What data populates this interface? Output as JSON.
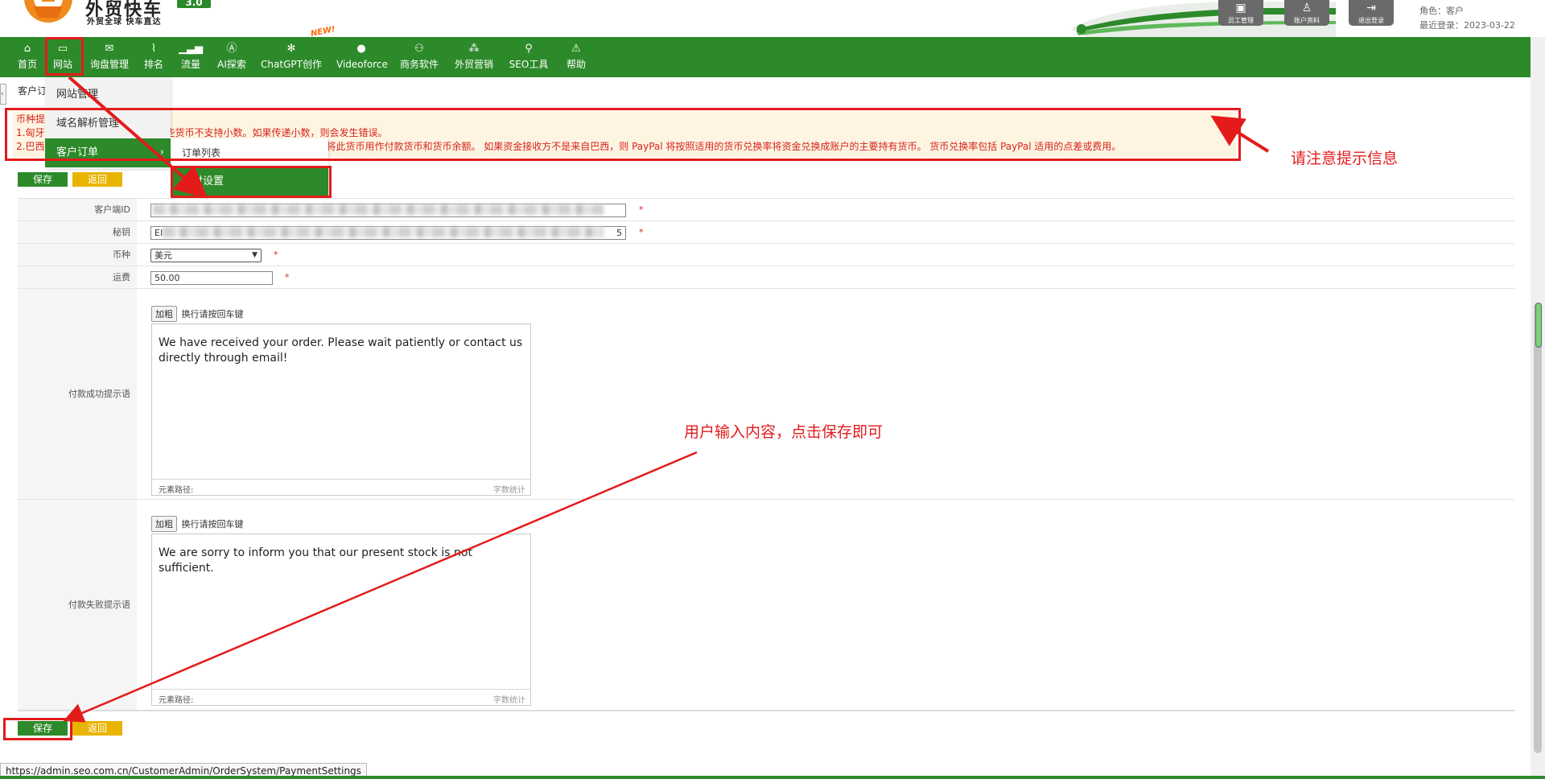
{
  "header": {
    "brand_title": "外贸快车",
    "brand_sub": "外贸全球 快车直达",
    "version": "3.0",
    "buttons": [
      {
        "label": "员工管理",
        "icon": "staff-icon"
      },
      {
        "label": "账户资料",
        "icon": "account-icon"
      },
      {
        "label": "退出登录",
        "icon": "logout-icon"
      }
    ],
    "role": "角色：客户",
    "last_login": "最近登录：2023-03-22"
  },
  "nav": {
    "items": [
      {
        "label": "首页",
        "icon": "home-icon"
      },
      {
        "label": "网站",
        "icon": "website-icon"
      },
      {
        "label": "询盘管理",
        "icon": "mail-icon"
      },
      {
        "label": "排名",
        "icon": "ranking-icon"
      },
      {
        "label": "流量",
        "icon": "traffic-icon"
      },
      {
        "label": "AI探索",
        "icon": "ai-icon"
      },
      {
        "label": "ChatGPT创作",
        "icon": "chatgpt-icon"
      },
      {
        "label": "Videoforce",
        "icon": "video-icon"
      },
      {
        "label": "商务软件",
        "icon": "software-icon"
      },
      {
        "label": "外贸营销",
        "icon": "marketing-icon"
      },
      {
        "label": "SEO工具",
        "icon": "seo-search-icon"
      },
      {
        "label": "帮助",
        "icon": "help-icon"
      }
    ],
    "new_badge": "NEW!"
  },
  "page_title": "客户订",
  "dropdown": {
    "items": [
      "网站管理",
      "域名解析管理",
      "客户订单"
    ],
    "submenu": [
      "订单列表",
      "支付设置"
    ]
  },
  "notice": {
    "line0": "币种提",
    "line1_prefix": "1.匈牙",
    "line1_suffix": "这些货币不支持小数。如果传递小数，则会发生错误。",
    "line2_prefix": "2.巴西",
    "line2_suffix": "将此货币用作付款货币和货币余额。 如果资金接收方不是来自巴西，则 PayPal 将按照适用的货币兑换率将资金兑换成账户的主要持有货币。 货币兑换率包括 PayPal 适用的点差或费用。"
  },
  "buttons": {
    "save": "保存",
    "back": "返回"
  },
  "form": {
    "client_id_label": "客户端ID",
    "secret_label": "秘钥",
    "secret_value_start": "EI",
    "secret_value_end": "5",
    "currency_label": "币种",
    "currency_value": "美元",
    "shipping_label": "运费",
    "shipping_value": "50.00",
    "required_mark": "*",
    "success_label": "付款成功提示语",
    "failure_label": "付款失败提示语",
    "bold_btn": "加粗",
    "newline_hint": "换行请按回车键",
    "success_text": "We have received your order. Please wait patiently or contact us directly through email!",
    "failure_text": "We are sorry to inform you that our present stock is not sufficient.",
    "element_path": "元素路径:",
    "word_count": "字数统计"
  },
  "annotations": {
    "notice_hint": "请注意提示信息",
    "save_hint": "用户输入内容，点击保存即可"
  },
  "status_url": "https://admin.seo.com.cn/CustomerAdmin/OrderSystem/PaymentSettings",
  "colors": {
    "green": "#2d8a2a",
    "red": "#e31b1b",
    "yellow": "#e8b400",
    "notice_bg": "#fdf5e2"
  }
}
